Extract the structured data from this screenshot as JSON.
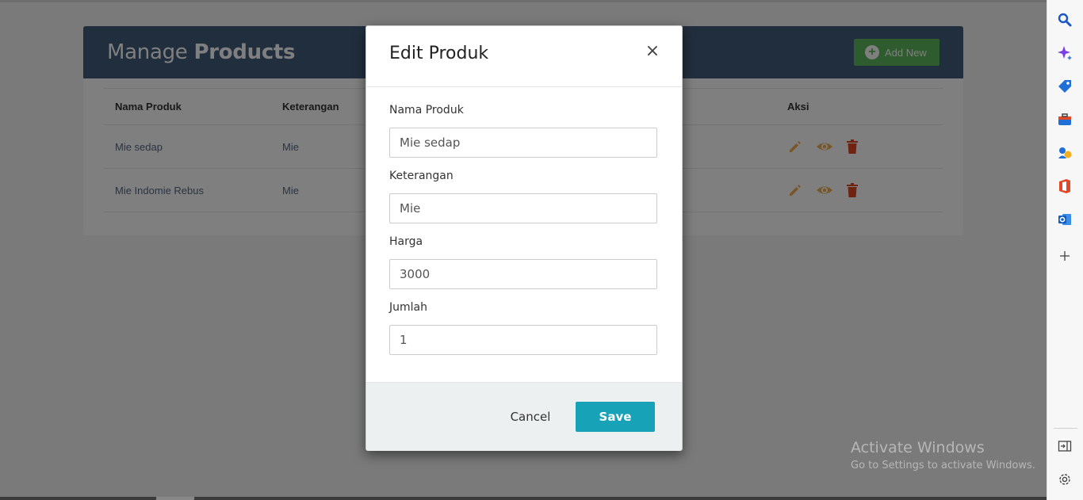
{
  "page": {
    "title_regular": "Manage",
    "title_bold": "Products",
    "add_new_label": "Add New"
  },
  "table": {
    "columns": [
      "Nama Produk",
      "Keterangan",
      "Aksi"
    ],
    "rows": [
      {
        "nama": "Mie sedap",
        "keterangan": "Mie"
      },
      {
        "nama": "Mie Indomie Rebus",
        "keterangan": "Mie"
      }
    ]
  },
  "modal": {
    "title": "Edit Produk",
    "close_symbol": "×",
    "fields": [
      {
        "label": "Nama Produk",
        "value": "Mie sedap"
      },
      {
        "label": "Keterangan",
        "value": "Mie"
      },
      {
        "label": "Harga",
        "value": "3000"
      },
      {
        "label": "Jumlah",
        "value": "1"
      }
    ],
    "cancel_label": "Cancel",
    "save_label": "Save"
  },
  "watermark": {
    "line1": "Activate Windows",
    "line2": "Go to Settings to activate Windows."
  },
  "sidebar": {
    "icons": [
      "search-icon",
      "copilot-sparkle-icon",
      "shopping-tag-icon",
      "toolbox-icon",
      "games-icon",
      "office-icon",
      "outlook-icon",
      "add-icon",
      "split-screen-icon",
      "settings-icon"
    ]
  },
  "colors": {
    "header": "#435d7d",
    "add_button": "#5cb85c",
    "save_button": "#17a2b8",
    "edit_icon": "#f0ad4e",
    "view_icon": "#f0ad4e",
    "delete_icon": "#e34724"
  }
}
